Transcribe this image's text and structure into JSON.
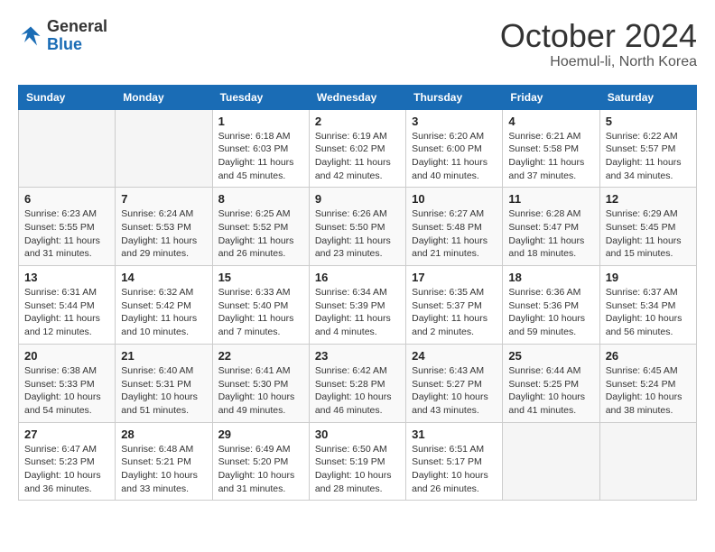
{
  "header": {
    "logo_general": "General",
    "logo_blue": "Blue",
    "month": "October 2024",
    "location": "Hoemul-li, North Korea"
  },
  "days_of_week": [
    "Sunday",
    "Monday",
    "Tuesday",
    "Wednesday",
    "Thursday",
    "Friday",
    "Saturday"
  ],
  "weeks": [
    [
      {
        "day": "",
        "empty": true
      },
      {
        "day": "",
        "empty": true
      },
      {
        "day": "1",
        "sunrise": "6:18 AM",
        "sunset": "6:03 PM",
        "daylight": "11 hours and 45 minutes."
      },
      {
        "day": "2",
        "sunrise": "6:19 AM",
        "sunset": "6:02 PM",
        "daylight": "11 hours and 42 minutes."
      },
      {
        "day": "3",
        "sunrise": "6:20 AM",
        "sunset": "6:00 PM",
        "daylight": "11 hours and 40 minutes."
      },
      {
        "day": "4",
        "sunrise": "6:21 AM",
        "sunset": "5:58 PM",
        "daylight": "11 hours and 37 minutes."
      },
      {
        "day": "5",
        "sunrise": "6:22 AM",
        "sunset": "5:57 PM",
        "daylight": "11 hours and 34 minutes."
      }
    ],
    [
      {
        "day": "6",
        "sunrise": "6:23 AM",
        "sunset": "5:55 PM",
        "daylight": "11 hours and 31 minutes."
      },
      {
        "day": "7",
        "sunrise": "6:24 AM",
        "sunset": "5:53 PM",
        "daylight": "11 hours and 29 minutes."
      },
      {
        "day": "8",
        "sunrise": "6:25 AM",
        "sunset": "5:52 PM",
        "daylight": "11 hours and 26 minutes."
      },
      {
        "day": "9",
        "sunrise": "6:26 AM",
        "sunset": "5:50 PM",
        "daylight": "11 hours and 23 minutes."
      },
      {
        "day": "10",
        "sunrise": "6:27 AM",
        "sunset": "5:48 PM",
        "daylight": "11 hours and 21 minutes."
      },
      {
        "day": "11",
        "sunrise": "6:28 AM",
        "sunset": "5:47 PM",
        "daylight": "11 hours and 18 minutes."
      },
      {
        "day": "12",
        "sunrise": "6:29 AM",
        "sunset": "5:45 PM",
        "daylight": "11 hours and 15 minutes."
      }
    ],
    [
      {
        "day": "13",
        "sunrise": "6:31 AM",
        "sunset": "5:44 PM",
        "daylight": "11 hours and 12 minutes."
      },
      {
        "day": "14",
        "sunrise": "6:32 AM",
        "sunset": "5:42 PM",
        "daylight": "11 hours and 10 minutes."
      },
      {
        "day": "15",
        "sunrise": "6:33 AM",
        "sunset": "5:40 PM",
        "daylight": "11 hours and 7 minutes."
      },
      {
        "day": "16",
        "sunrise": "6:34 AM",
        "sunset": "5:39 PM",
        "daylight": "11 hours and 4 minutes."
      },
      {
        "day": "17",
        "sunrise": "6:35 AM",
        "sunset": "5:37 PM",
        "daylight": "11 hours and 2 minutes."
      },
      {
        "day": "18",
        "sunrise": "6:36 AM",
        "sunset": "5:36 PM",
        "daylight": "10 hours and 59 minutes."
      },
      {
        "day": "19",
        "sunrise": "6:37 AM",
        "sunset": "5:34 PM",
        "daylight": "10 hours and 56 minutes."
      }
    ],
    [
      {
        "day": "20",
        "sunrise": "6:38 AM",
        "sunset": "5:33 PM",
        "daylight": "10 hours and 54 minutes."
      },
      {
        "day": "21",
        "sunrise": "6:40 AM",
        "sunset": "5:31 PM",
        "daylight": "10 hours and 51 minutes."
      },
      {
        "day": "22",
        "sunrise": "6:41 AM",
        "sunset": "5:30 PM",
        "daylight": "10 hours and 49 minutes."
      },
      {
        "day": "23",
        "sunrise": "6:42 AM",
        "sunset": "5:28 PM",
        "daylight": "10 hours and 46 minutes."
      },
      {
        "day": "24",
        "sunrise": "6:43 AM",
        "sunset": "5:27 PM",
        "daylight": "10 hours and 43 minutes."
      },
      {
        "day": "25",
        "sunrise": "6:44 AM",
        "sunset": "5:25 PM",
        "daylight": "10 hours and 41 minutes."
      },
      {
        "day": "26",
        "sunrise": "6:45 AM",
        "sunset": "5:24 PM",
        "daylight": "10 hours and 38 minutes."
      }
    ],
    [
      {
        "day": "27",
        "sunrise": "6:47 AM",
        "sunset": "5:23 PM",
        "daylight": "10 hours and 36 minutes."
      },
      {
        "day": "28",
        "sunrise": "6:48 AM",
        "sunset": "5:21 PM",
        "daylight": "10 hours and 33 minutes."
      },
      {
        "day": "29",
        "sunrise": "6:49 AM",
        "sunset": "5:20 PM",
        "daylight": "10 hours and 31 minutes."
      },
      {
        "day": "30",
        "sunrise": "6:50 AM",
        "sunset": "5:19 PM",
        "daylight": "10 hours and 28 minutes."
      },
      {
        "day": "31",
        "sunrise": "6:51 AM",
        "sunset": "5:17 PM",
        "daylight": "10 hours and 26 minutes."
      },
      {
        "day": "",
        "empty": true
      },
      {
        "day": "",
        "empty": true
      }
    ]
  ],
  "labels": {
    "sunrise": "Sunrise:",
    "sunset": "Sunset:",
    "daylight": "Daylight:"
  }
}
